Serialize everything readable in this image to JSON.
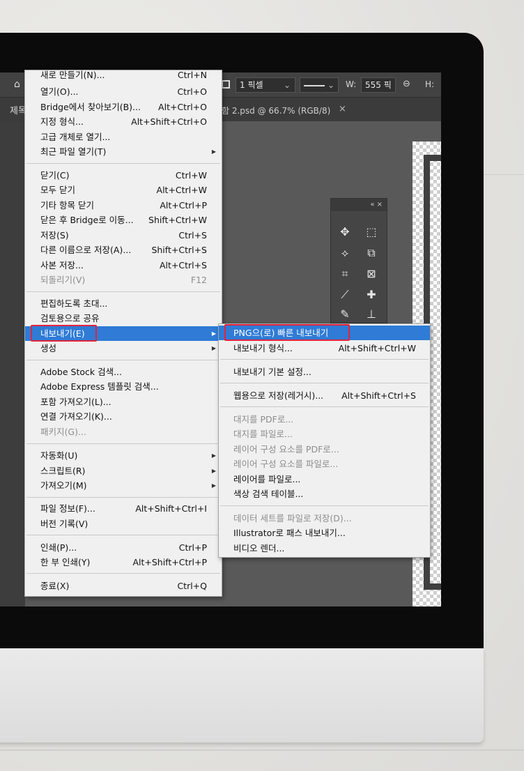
{
  "options_bar": {
    "stroke_width": "1 픽셀",
    "w_label": "W:",
    "w_value": "555 픽",
    "h_label": "H:"
  },
  "tabs": {
    "first_fragment": "제목",
    "document_tab": "함 2.psd @ 66.7% (RGB/8)",
    "close": "×"
  },
  "tool_panel": {
    "header": "« ×"
  },
  "file_menu": {
    "items": [
      {
        "label": "새로 만들기(N)...",
        "shortcut": "Ctrl+N"
      },
      {
        "label": "열기(O)...",
        "shortcut": "Ctrl+O"
      },
      {
        "label": "Bridge에서 찾아보기(B)...",
        "shortcut": "Alt+Ctrl+O"
      },
      {
        "label": "지정 형식...",
        "shortcut": "Alt+Shift+Ctrl+O"
      },
      {
        "label": "고급 개체로 열기...",
        "shortcut": ""
      },
      {
        "label": "최근 파일 열기(T)",
        "shortcut": ""
      },
      {
        "label": "닫기(C)",
        "shortcut": "Ctrl+W"
      },
      {
        "label": "모두 닫기",
        "shortcut": "Alt+Ctrl+W"
      },
      {
        "label": "기타 항목 닫기",
        "shortcut": "Alt+Ctrl+P"
      },
      {
        "label": "닫은 후 Bridge로 이동...",
        "shortcut": "Shift+Ctrl+W"
      },
      {
        "label": "저장(S)",
        "shortcut": "Ctrl+S"
      },
      {
        "label": "다른 이름으로 저장(A)...",
        "shortcut": "Shift+Ctrl+S"
      },
      {
        "label": "사본 저장...",
        "shortcut": "Alt+Ctrl+S"
      },
      {
        "label": "되돌리기(V)",
        "shortcut": "F12"
      },
      {
        "label": "편집하도록 초대...",
        "shortcut": ""
      },
      {
        "label": "검토용으로 공유",
        "shortcut": ""
      },
      {
        "label": "내보내기(E)",
        "shortcut": ""
      },
      {
        "label": "생성",
        "shortcut": ""
      },
      {
        "label": "Adobe Stock 검색...",
        "shortcut": ""
      },
      {
        "label": "Adobe Express 템플릿 검색...",
        "shortcut": ""
      },
      {
        "label": "포함 가져오기(L)...",
        "shortcut": ""
      },
      {
        "label": "연결 가져오기(K)...",
        "shortcut": ""
      },
      {
        "label": "패키지(G)...",
        "shortcut": ""
      },
      {
        "label": "자동화(U)",
        "shortcut": ""
      },
      {
        "label": "스크립트(R)",
        "shortcut": ""
      },
      {
        "label": "가져오기(M)",
        "shortcut": ""
      },
      {
        "label": "파일 정보(F)...",
        "shortcut": "Alt+Shift+Ctrl+I"
      },
      {
        "label": "버전 기록(V)",
        "shortcut": ""
      },
      {
        "label": "인쇄(P)...",
        "shortcut": "Ctrl+P"
      },
      {
        "label": "한 부 인쇄(Y)",
        "shortcut": "Alt+Shift+Ctrl+P"
      },
      {
        "label": "종료(X)",
        "shortcut": "Ctrl+Q"
      }
    ]
  },
  "export_submenu": {
    "items": [
      {
        "label": "PNG으(로) 빠른 내보내기",
        "shortcut": ""
      },
      {
        "label": "내보내기 형식...",
        "shortcut": "Alt+Shift+Ctrl+W"
      },
      {
        "label": "내보내기 기본 설정...",
        "shortcut": ""
      },
      {
        "label": "웹용으로 저장(레거시)...",
        "shortcut": "Alt+Shift+Ctrl+S"
      },
      {
        "label": "대지를 PDF로...",
        "shortcut": ""
      },
      {
        "label": "대지를 파일로...",
        "shortcut": ""
      },
      {
        "label": "레이어 구성 요소를 PDF로...",
        "shortcut": ""
      },
      {
        "label": "레이어 구성 요소를 파일로...",
        "shortcut": ""
      },
      {
        "label": "레이어를 파일로...",
        "shortcut": ""
      },
      {
        "label": "색상 검색 테이블...",
        "shortcut": ""
      },
      {
        "label": "데이터 세트를 파일로 저장(D)...",
        "shortcut": ""
      },
      {
        "label": "Illustrator로 패스 내보내기...",
        "shortcut": ""
      },
      {
        "label": "비디오 렌더...",
        "shortcut": ""
      }
    ]
  },
  "colors": {
    "menu_highlight": "#2f7bd6",
    "annotation_red": "#e5233a",
    "bezel": "#0b0b0b"
  }
}
